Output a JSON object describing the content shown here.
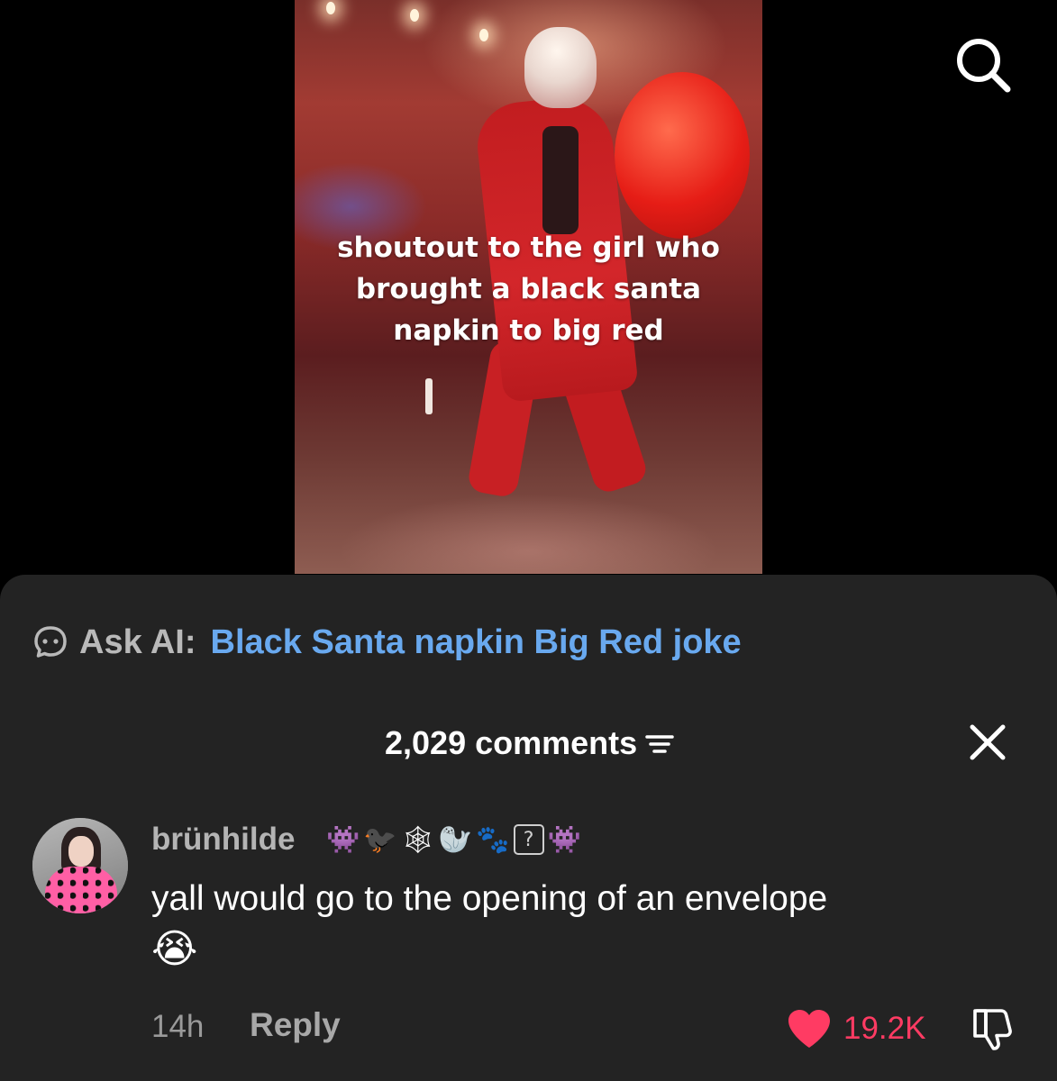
{
  "video": {
    "caption_lines": [
      "shoutout to the girl who",
      "brought a black santa",
      "napkin to big red"
    ]
  },
  "top_bar": {
    "search_icon": "search-icon"
  },
  "ask_ai": {
    "label": "Ask AI:",
    "query": "Black Santa napkin Big Red joke",
    "icon": "ai-chat-icon"
  },
  "comments": {
    "count_label": "2,029 comments",
    "sort_icon": "sort-icon",
    "close_icon": "close-icon"
  },
  "comment": {
    "username": "brünhilde",
    "badges": [
      "👾",
      "🐦‍⬛",
      "🕸",
      "🦭",
      "🐾",
      "?",
      "👾"
    ],
    "text": "yall would go to the opening of an envelope",
    "emoji": "😭",
    "time": "14h",
    "reply_label": "Reply",
    "likes": "19.2K",
    "like_color": "#ff3b63"
  },
  "colors": {
    "sheet_bg": "#232323",
    "ask_query": "#69a9ef",
    "background": "#000000"
  }
}
